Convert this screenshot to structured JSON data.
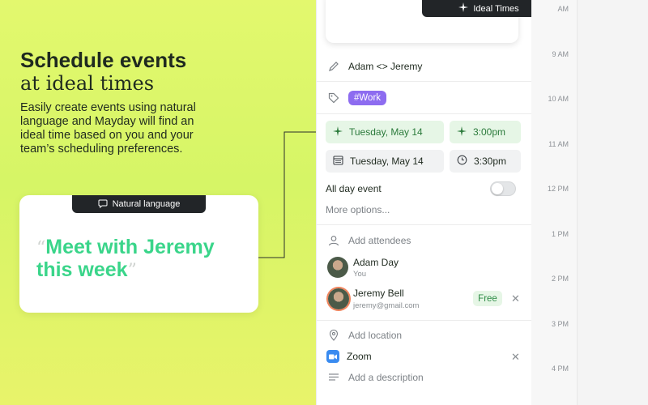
{
  "hero": {
    "title_line1": "Schedule events",
    "title_line2": "at ideal times",
    "description": "Easily create events using natural language and Mayday will find an ideal time based on you and your team’s scheduling preferences."
  },
  "natural_language": {
    "badge_label": "Natural language",
    "quote": "Meet with Jeremy this week"
  },
  "ideal_times_label": "Ideal Times",
  "event": {
    "title": "Adam <> Jeremy",
    "tag": "#Work",
    "start_date": "Tuesday, May 14",
    "start_time": "3:00pm",
    "end_date": "Tuesday, May 14",
    "end_time": "3:30pm",
    "all_day_label": "All day event",
    "all_day_enabled": false,
    "more_options": "More options...",
    "add_attendees": "Add attendees",
    "attendees": [
      {
        "name": "Adam Day",
        "sub": "You"
      },
      {
        "name": "Jeremy Bell",
        "sub": "jeremy@gmail.com",
        "status": "Free"
      }
    ],
    "add_location": "Add location",
    "location": "Zoom",
    "add_description": "Add a description"
  },
  "timeline": {
    "hours": [
      "9 AM",
      "10 AM",
      "11 AM",
      "12 PM",
      "1 PM",
      "2 PM",
      "3 PM",
      "4 PM"
    ]
  },
  "colors": {
    "accent_green": "#3ad58a",
    "tag_purple": "#8d6cf0",
    "dark": "#222528"
  }
}
